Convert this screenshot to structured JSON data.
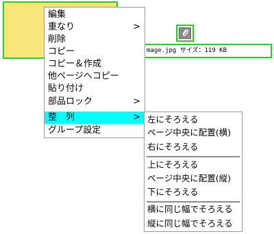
{
  "file_info": {
    "text": "mage.jpg  サイズ：119 KB"
  },
  "menu": {
    "items": [
      {
        "label": "編集",
        "submenu": false
      },
      {
        "label": "重なり",
        "submenu": true
      },
      {
        "label": "削除",
        "submenu": false
      },
      {
        "label": "コピー",
        "submenu": false
      },
      {
        "label": "コピー＆作成",
        "submenu": false
      },
      {
        "label": "他ページへコピー",
        "submenu": false
      },
      {
        "label": "貼り付け",
        "submenu": false
      },
      {
        "label": "部品ロック",
        "submenu": true
      },
      {
        "label": "整　列",
        "submenu": true,
        "highlighted": true
      },
      {
        "label": "グループ設定",
        "submenu": false
      }
    ],
    "arrow_glyph": ">"
  },
  "align_submenu": {
    "items": [
      {
        "label": "左にそろえる"
      },
      {
        "label": "ページ中央に配置(横)"
      },
      {
        "label": "右にそろえる"
      },
      {
        "label": "上にそろえる"
      },
      {
        "label": "ページ中央に配置(縦)"
      },
      {
        "label": "下にそろえる"
      },
      {
        "label": "横に同じ幅でそろえる"
      },
      {
        "label": "縦に同じ幅でそろえる"
      }
    ]
  },
  "colors": {
    "highlight": "#00ffff",
    "selection_border": "#23d323",
    "sticky_note": "#f9e679"
  },
  "icons": {
    "attach": "paperclip-icon"
  }
}
